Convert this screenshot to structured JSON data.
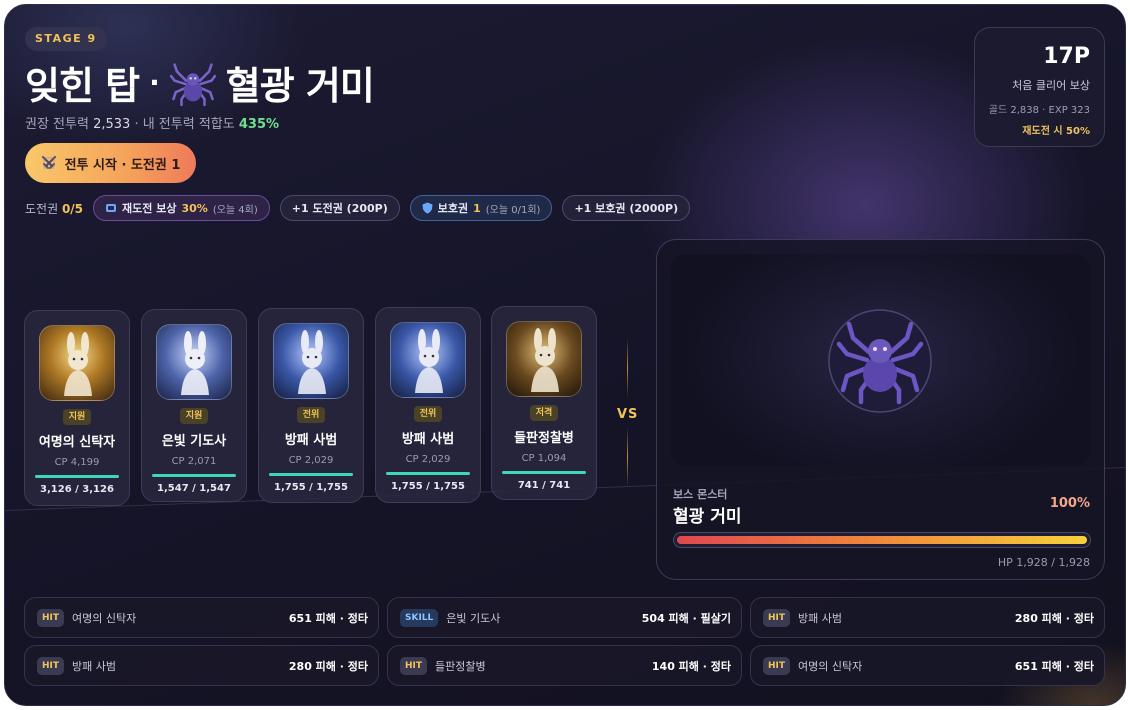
{
  "stage_label": "STAGE 9",
  "title": {
    "place": "잊힌 탑",
    "sep": "·",
    "boss": "혈광 거미"
  },
  "power_line": {
    "rec_label": "권장 전투력",
    "rec_value": "2,533",
    "dot": "·",
    "my_label": "내 전투력 적합도",
    "fit": "435%"
  },
  "start_button": {
    "label": "전투 시작 · 도전권 1",
    "icon": "crossed-swords-icon"
  },
  "tickets": {
    "label": "도전권",
    "value": "0/5",
    "retry_pill": {
      "icon": "ticket-icon",
      "label": "재도전 보상",
      "value": "30%",
      "sub": "(오늘 4회)"
    },
    "buy_ticket": "+1 도전권 (200P)",
    "shield_pill": {
      "icon": "shield-icon",
      "label": "보호권",
      "value": "1",
      "sub": "(오늘 0/1회)"
    },
    "buy_shield": "+1 보호권 (2000P)"
  },
  "reward": {
    "points": "17P",
    "label": "처음 클리어 보상",
    "detail": "골드 2,838 · EXP 323",
    "retry": "재도전 시 50%"
  },
  "units": [
    {
      "role": "지원",
      "name": "여명의 신탁자",
      "cp": "CP 4,199",
      "hp": "3,126 / 3,126",
      "hp_ratio": 1.0,
      "theme": "gold"
    },
    {
      "role": "지원",
      "name": "은빛 기도사",
      "cp": "CP 2,071",
      "hp": "1,547 / 1,547",
      "hp_ratio": 1.0,
      "theme": "silver"
    },
    {
      "role": "전위",
      "name": "방패 사범",
      "cp": "CP 2,029",
      "hp": "1,755 / 1,755",
      "hp_ratio": 1.0,
      "theme": "blue"
    },
    {
      "role": "전위",
      "name": "방패 사범",
      "cp": "CP 2,029",
      "hp": "1,755 / 1,755",
      "hp_ratio": 1.0,
      "theme": "blue"
    },
    {
      "role": "저격",
      "name": "들판정찰병",
      "cp": "CP 1,094",
      "hp": "741 / 741",
      "hp_ratio": 1.0,
      "theme": "forest"
    }
  ],
  "vs": "VS",
  "boss": {
    "label": "보스 몬스터",
    "name": "혈광 거미",
    "pct": "100%",
    "hp": "HP 1,928 / 1,928",
    "hp_ratio": 1.0,
    "icon": "spider-icon"
  },
  "logs": [
    {
      "tag": "HIT",
      "who": "여명의 신탁자",
      "result": "651 피해 · 정타"
    },
    {
      "tag": "SKILL",
      "who": "은빛 기도사",
      "result": "504 피해 · 필살기"
    },
    {
      "tag": "HIT",
      "who": "방패 사범",
      "result": "280 피해 · 정타"
    },
    {
      "tag": "HIT",
      "who": "방패 사범",
      "result": "280 피해 · 정타"
    },
    {
      "tag": "HIT",
      "who": "들판정찰병",
      "result": "140 피해 · 정타"
    },
    {
      "tag": "HIT",
      "who": "여명의 신탁자",
      "result": "651 피해 · 정타"
    }
  ],
  "colors": {
    "accent_gold": "#f0c35a",
    "fit_green": "#6fe08f",
    "hp_teal": "#3fd6c0",
    "boss_pct": "#f3a68a"
  }
}
